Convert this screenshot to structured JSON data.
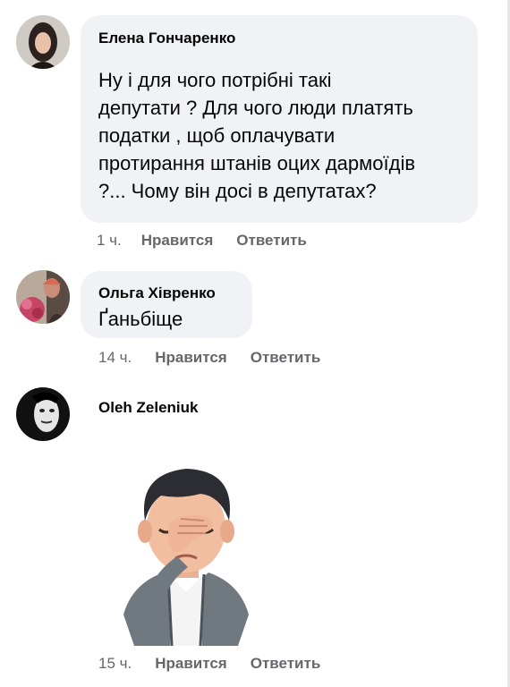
{
  "comments": [
    {
      "author": "Елена Гончаренко",
      "text_lines": [
        "Ну і для чого потрібні такі",
        "депутати ?  Для чого люди платять",
        "податки , щоб оплачувати",
        "протирання штанів оцих дармоїдів",
        "?...  Чому він досі в депутатах?"
      ],
      "time": "1 ч.",
      "like_label": "Нравится",
      "reply_label": "Ответить"
    },
    {
      "author": "Ольга Хівренко",
      "text_lines": [
        "Ґаньбіще"
      ],
      "time": "14 ч.",
      "like_label": "Нравится",
      "reply_label": "Ответить"
    },
    {
      "author": "Oleh Zeleniuk",
      "sticker": "facepalm-avatar-sticker",
      "time": "15 ч.",
      "like_label": "Нравится",
      "reply_label": "Ответить"
    }
  ],
  "colors": {
    "bubble": "#f0f2f5",
    "meta_text": "#65676b",
    "text": "#050505"
  }
}
